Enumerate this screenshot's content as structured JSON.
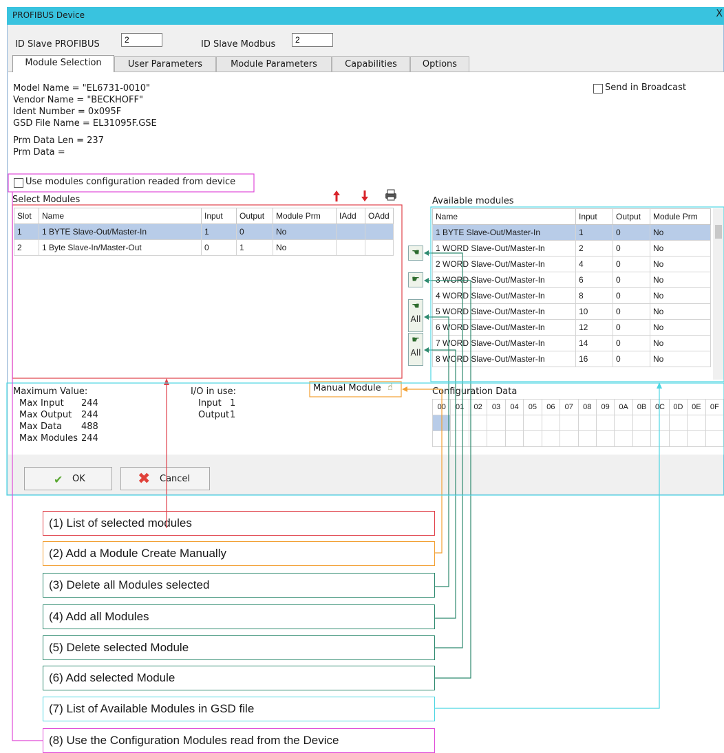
{
  "window": {
    "title": "PROFIBUS Device",
    "close": "X"
  },
  "ids": {
    "profibus_label": "ID Slave PROFIBUS",
    "profibus_value": "2",
    "modbus_label": "ID Slave Modbus",
    "modbus_value": "2"
  },
  "tabs": [
    "Module Selection",
    "User Parameters",
    "Module Parameters",
    "Capabilities",
    "Options"
  ],
  "info": {
    "model": "Model Name = \"EL6731-0010\"",
    "vendor": "Vendor Name = \"BECKHOFF\"",
    "ident": "Ident Number = 0x095F",
    "gsd": "GSD File Name = EL31095F.GSE",
    "prm_len": "Prm Data Len = 237",
    "prm_data": "Prm Data ="
  },
  "broadcast_label": "Send in Broadcast",
  "use_modules_label": "Use modules configuration readed from device",
  "select_modules": {
    "title": "Select Modules",
    "columns": [
      "Slot",
      "Name",
      "Input",
      "Output",
      "Module Prm",
      "IAdd",
      "OAdd"
    ],
    "rows": [
      [
        "1",
        "1 BYTE Slave-Out/Master-In",
        "1",
        "0",
        "No",
        "",
        ""
      ],
      [
        "2",
        "1 Byte Slave-In/Master-Out",
        "0",
        "1",
        "No",
        "",
        ""
      ]
    ]
  },
  "available_modules": {
    "title": "Available modules",
    "columns": [
      "Name",
      "Input",
      "Output",
      "Module Prm"
    ],
    "rows": [
      [
        "1 BYTE Slave-Out/Master-In",
        "1",
        "0",
        "No"
      ],
      [
        "1 WORD Slave-Out/Master-In",
        "2",
        "0",
        "No"
      ],
      [
        "2 WORD Slave-Out/Master-In",
        "4",
        "0",
        "No"
      ],
      [
        "3 WORD Slave-Out/Master-In",
        "6",
        "0",
        "No"
      ],
      [
        "4 WORD Slave-Out/Master-In",
        "8",
        "0",
        "No"
      ],
      [
        "5 WORD Slave-Out/Master-In",
        "10",
        "0",
        "No"
      ],
      [
        "6 WORD Slave-Out/Master-In",
        "12",
        "0",
        "No"
      ],
      [
        "7 WORD Slave-Out/Master-In",
        "14",
        "0",
        "No"
      ],
      [
        "8 WORD Slave-Out/Master-In",
        "16",
        "0",
        "No"
      ]
    ]
  },
  "arrow_buttons": {
    "all1": "All",
    "all2": "All"
  },
  "manual_module_label": "Manual Module",
  "config_data": {
    "title": "Configuration Data",
    "columns": [
      "00",
      "01",
      "02",
      "03",
      "04",
      "05",
      "06",
      "07",
      "08",
      "09",
      "0A",
      "0B",
      "0C",
      "0D",
      "0E",
      "0F"
    ]
  },
  "max": {
    "title": "Maximum Value:",
    "rows": [
      [
        "Max Input",
        "244"
      ],
      [
        "Max Output",
        "244"
      ],
      [
        "Max Data",
        "488"
      ],
      [
        "Max Modules",
        "244"
      ]
    ]
  },
  "io": {
    "title": "I/O in use:",
    "rows": [
      [
        "Input",
        "1"
      ],
      [
        "Output",
        "1"
      ]
    ]
  },
  "buttons": {
    "ok": "OK",
    "cancel": "Cancel"
  },
  "legend": [
    {
      "text": "(1) List of selected modules",
      "color": "#e0414a"
    },
    {
      "text": "(2) Add a Module Create Manually",
      "color": "#f2a033"
    },
    {
      "text": "(3) Delete all Modules selected",
      "color": "#2e8a6f"
    },
    {
      "text": "(4) Add all Modules",
      "color": "#2e8a6f"
    },
    {
      "text": "(5) Delete selected Module",
      "color": "#2e8a6f"
    },
    {
      "text": "(6) Add selected Module",
      "color": "#2e8a6f"
    },
    {
      "text": "(7) List of Available Modules in GSD file",
      "color": "#4cd6e2"
    },
    {
      "text": "(8) Use the Configuration Modules read from the Device",
      "color": "#e04ad8"
    }
  ]
}
